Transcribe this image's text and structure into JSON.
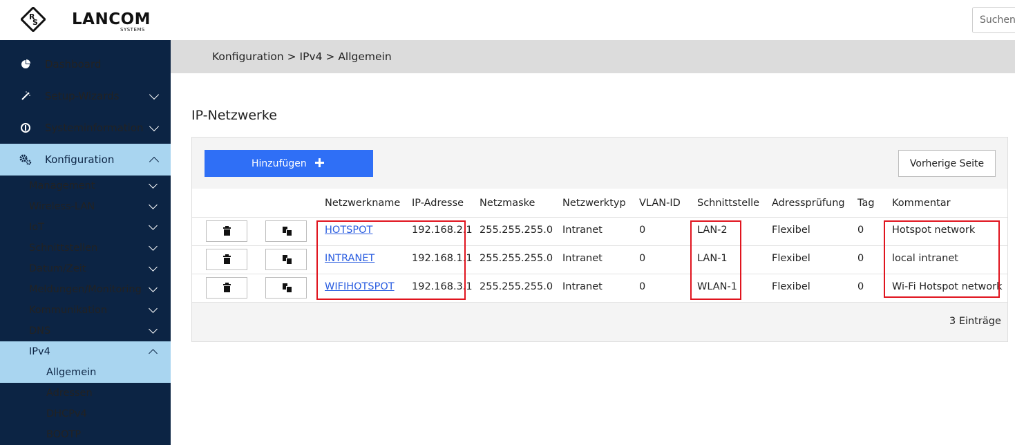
{
  "header": {
    "brand": "LANCOM",
    "brand_sub": "SYSTEMS",
    "search_placeholder": "Suchen..."
  },
  "sidebar": {
    "top_items": [
      {
        "label": "Dashboard",
        "icon": "dashboard-icon"
      },
      {
        "label": "Setup-Wizards",
        "icon": "wand-icon"
      },
      {
        "label": "Systeminformation",
        "icon": "info-icon"
      },
      {
        "label": "Konfiguration",
        "icon": "gears-icon"
      }
    ],
    "config_items": [
      {
        "label": "Management"
      },
      {
        "label": "Wireless-LAN"
      },
      {
        "label": "IoT"
      },
      {
        "label": "Schnittstellen"
      },
      {
        "label": "Datum/Zeit"
      },
      {
        "label": "Meldungen/Monitoring"
      },
      {
        "label": "Kommunikation"
      },
      {
        "label": "DNS"
      },
      {
        "label": "IPv4"
      }
    ],
    "ipv4_items": [
      {
        "label": "Allgemein"
      },
      {
        "label": "Adressen"
      },
      {
        "label": "DHCPv4"
      },
      {
        "label": "BOOTP"
      }
    ]
  },
  "breadcrumb": "Konfiguration > IPv4 > Allgemein",
  "section_title": "IP-Netzwerke",
  "toolbar": {
    "add_label": "Hinzufügen",
    "prev_label": "Vorherige Seite"
  },
  "table": {
    "columns": [
      "Netzwerkname",
      "IP-Adresse",
      "Netzmaske",
      "Netzwerktyp",
      "VLAN-ID",
      "Schnittstelle",
      "Adressprüfung",
      "Tag",
      "Kommentar"
    ],
    "rows": [
      [
        "HOTSPOT",
        "192.168.2.1",
        "255.255.255.0",
        "Intranet",
        "0",
        "LAN-2",
        "Flexibel",
        "0",
        "Hotspot network"
      ],
      [
        "INTRANET",
        "192.168.1.1",
        "255.255.255.0",
        "Intranet",
        "0",
        "LAN-1",
        "Flexibel",
        "0",
        "local intranet"
      ],
      [
        "WIFIHOTSPOT",
        "192.168.3.1",
        "255.255.255.0",
        "Intranet",
        "0",
        "WLAN-1",
        "Flexibel",
        "0",
        "Wi-Fi Hotspot network"
      ]
    ]
  },
  "count_label": "3 Einträge",
  "colors": {
    "sidebar_bg": "#0c2444",
    "active_bg": "#a9d5f0",
    "accent": "#2f6ff6",
    "highlight": "#e0141e"
  }
}
